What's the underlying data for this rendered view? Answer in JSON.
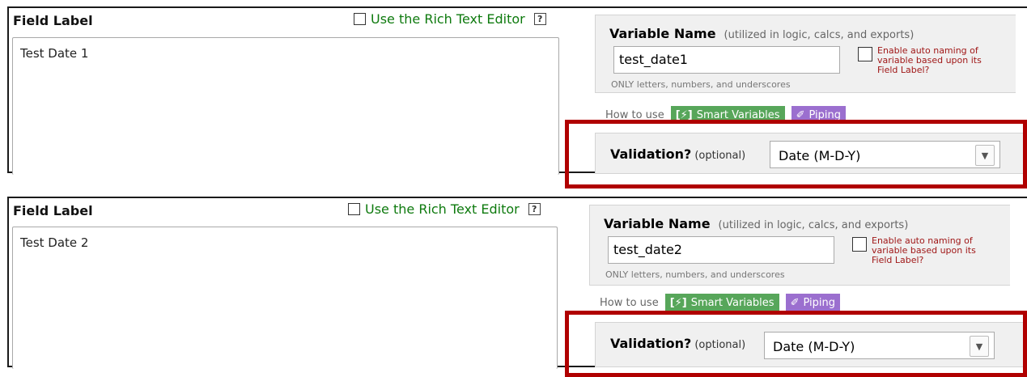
{
  "fields": [
    {
      "field_label_title": "Field Label",
      "rte_label": "Use the Rich Text Editor",
      "help": "?",
      "label_value": "Test Date 1",
      "var_title": "Variable Name",
      "var_hint": "(utilized in logic, calcs, and exports)",
      "var_value": "test_date1",
      "var_note": "ONLY letters, numbers, and underscores",
      "auto_label": "Enable auto naming of variable based upon its Field Label?",
      "howto": "How to use",
      "smart_sym": "[⚡]",
      "smart_label": "Smart Variables",
      "piping_label": "Piping",
      "validation_label": "Validation?",
      "validation_optional": "(optional)",
      "validation_value": "Date (M-D-Y)"
    },
    {
      "field_label_title": "Field Label",
      "rte_label": "Use the Rich Text Editor",
      "help": "?",
      "label_value": "Test Date 2",
      "var_title": "Variable Name",
      "var_hint": "(utilized in logic, calcs, and exports)",
      "var_value": "test_date2",
      "var_note": "ONLY letters, numbers, and underscores",
      "auto_label": "Enable auto naming of variable based upon its Field Label?",
      "howto": "How to use",
      "smart_sym": "[⚡]",
      "smart_label": "Smart Variables",
      "piping_label": "Piping",
      "validation_label": "Validation?",
      "validation_optional": "(optional)",
      "validation_value": "Date (M-D-Y)"
    }
  ],
  "colors": {
    "highlight": "#b00000",
    "smart": "#57a65a",
    "piping": "#9b6fcf",
    "rte_text": "#0e7a0e",
    "auto_text": "#a01818"
  }
}
